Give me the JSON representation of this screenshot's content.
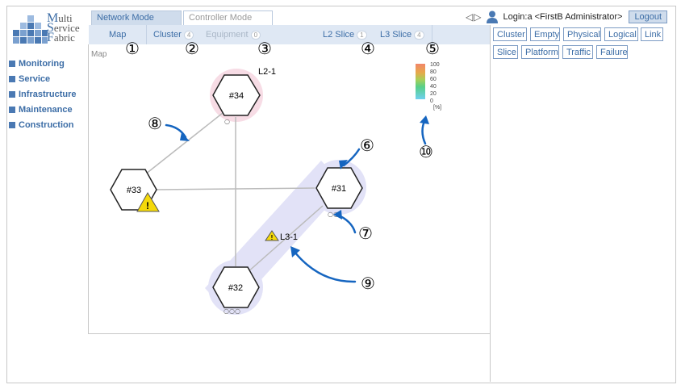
{
  "logo": {
    "line1_initial": "M",
    "line1_rest": "ulti",
    "line2_initial": "S",
    "line2_rest": "ervice",
    "line3_initial": "F",
    "line3_rest": "abric"
  },
  "nav": {
    "items": [
      {
        "label": "Monitoring"
      },
      {
        "label": "Service"
      },
      {
        "label": "Infrastructure"
      },
      {
        "label": "Maintenance"
      },
      {
        "label": "Construction"
      }
    ]
  },
  "modes": {
    "network": "Network Mode",
    "controller": "Controller Mode"
  },
  "subtabs": {
    "map": {
      "label": "Map"
    },
    "cluster": {
      "label": "Cluster",
      "count": "4"
    },
    "equipment": {
      "label": "Equipment",
      "count": "0"
    },
    "l2": {
      "label": "L2 Slice",
      "count": "1"
    },
    "l3": {
      "label": "L3 Slice",
      "count": "4"
    }
  },
  "header": {
    "arrows": "◁▷",
    "login": "Login:a <FirstB Administrator>",
    "logout": "Logout"
  },
  "filters": [
    "Cluster",
    "Empty",
    "Physical",
    "Logical",
    "Link",
    "Slice",
    "Platform",
    "Traffic",
    "Failure"
  ],
  "map": {
    "title": "Map",
    "nodes": {
      "n34": "#34",
      "n33": "#33",
      "n31": "#31",
      "n32": "#32"
    },
    "labels": {
      "l2": "L2-1",
      "l3": "L3-1"
    },
    "ports": {
      "p34": "○",
      "p31": "○○",
      "p32": "○○○"
    },
    "legend": {
      "ticks": [
        "100",
        "80",
        "60",
        "40",
        "20",
        "0"
      ],
      "unit": "[%]"
    }
  },
  "callouts": [
    "①",
    "②",
    "③",
    "④",
    "⑤",
    "⑥",
    "⑦",
    "⑧",
    "⑨",
    "⑩"
  ],
  "colors": {
    "accent": "#3c6da6",
    "annotation_arrow": "#1565c0",
    "warning": "#f5d90a",
    "l2_highlight": "#f7dce5",
    "l3_highlight": "#e2e2f7"
  }
}
